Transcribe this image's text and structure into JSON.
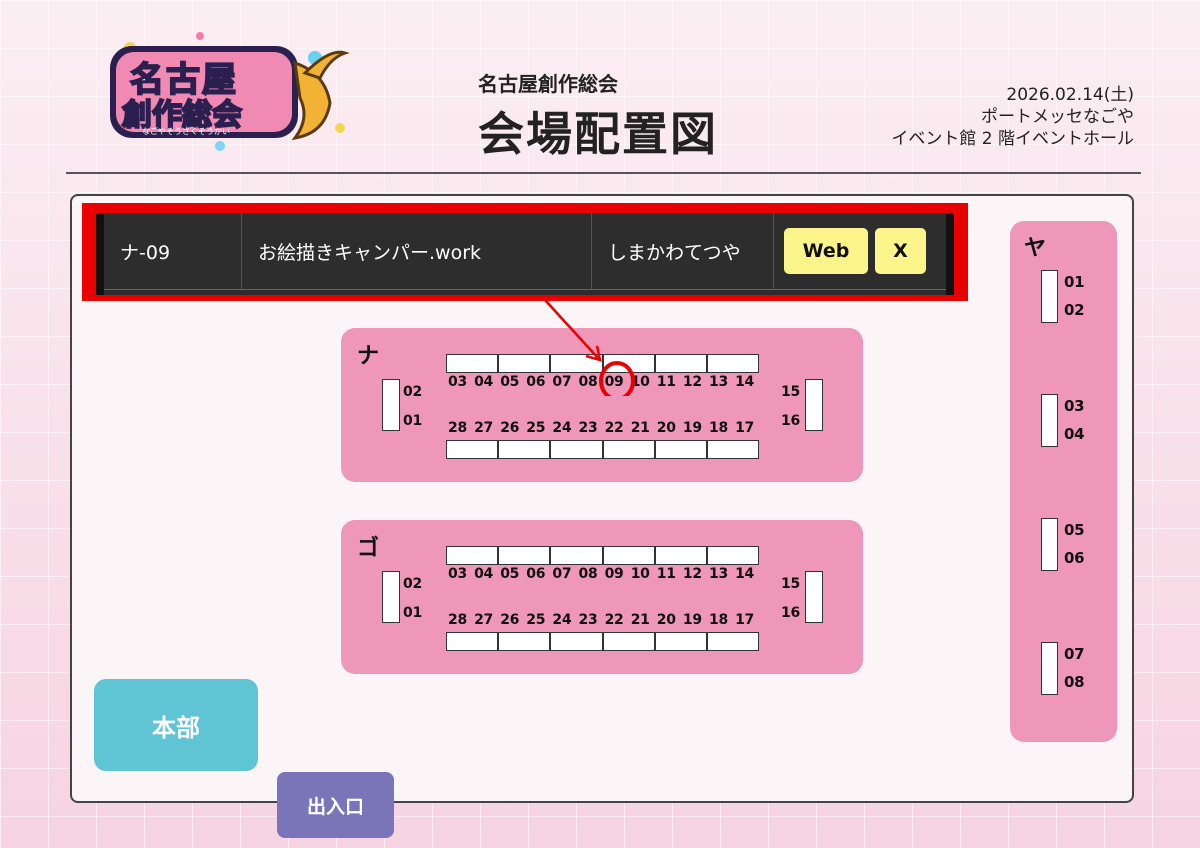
{
  "logo": {
    "line1": "名古屋",
    "line2": "創作総会",
    "tagline": "なごやそうさくそうかい"
  },
  "header": {
    "event_name": "名古屋創作総会",
    "page_title": "会場配置図",
    "date": "2026.02.14(土)",
    "venue": "ポートメッセなごや",
    "hall": "イベント館 2 階イベントホール"
  },
  "selected": {
    "space": "ナ-09",
    "circle": "お絵描きキャンパー.work",
    "author": "しまかわてつや",
    "links": [
      "Web",
      "X"
    ]
  },
  "blocks": {
    "na": {
      "label": "ナ",
      "left_ends": [
        "02",
        "01"
      ],
      "top_row": [
        "03",
        "04",
        "05",
        "06",
        "07",
        "08",
        "09",
        "10",
        "11",
        "12",
        "13",
        "14"
      ],
      "bottom_row": [
        "28",
        "27",
        "26",
        "25",
        "24",
        "23",
        "22",
        "21",
        "20",
        "19",
        "18",
        "17"
      ],
      "right_ends": [
        "15",
        "16"
      ],
      "highlight": "09"
    },
    "go": {
      "label": "ゴ",
      "left_ends": [
        "02",
        "01"
      ],
      "top_row": [
        "03",
        "04",
        "05",
        "06",
        "07",
        "08",
        "09",
        "10",
        "11",
        "12",
        "13",
        "14"
      ],
      "bottom_row": [
        "28",
        "27",
        "26",
        "25",
        "24",
        "23",
        "22",
        "21",
        "20",
        "19",
        "18",
        "17"
      ],
      "right_ends": [
        "15",
        "16"
      ]
    },
    "ya": {
      "label": "ヤ",
      "pairs": [
        [
          "01",
          "02"
        ],
        [
          "03",
          "04"
        ],
        [
          "05",
          "06"
        ],
        [
          "07",
          "08"
        ]
      ]
    }
  },
  "honbu": "本部",
  "entrance": "出入口",
  "colors": {
    "highlight": "#e80000",
    "block": "#ef97b8",
    "honbu": "#5fc4d3",
    "entrance": "#7a74b8",
    "link_button": "#fbf58c"
  }
}
